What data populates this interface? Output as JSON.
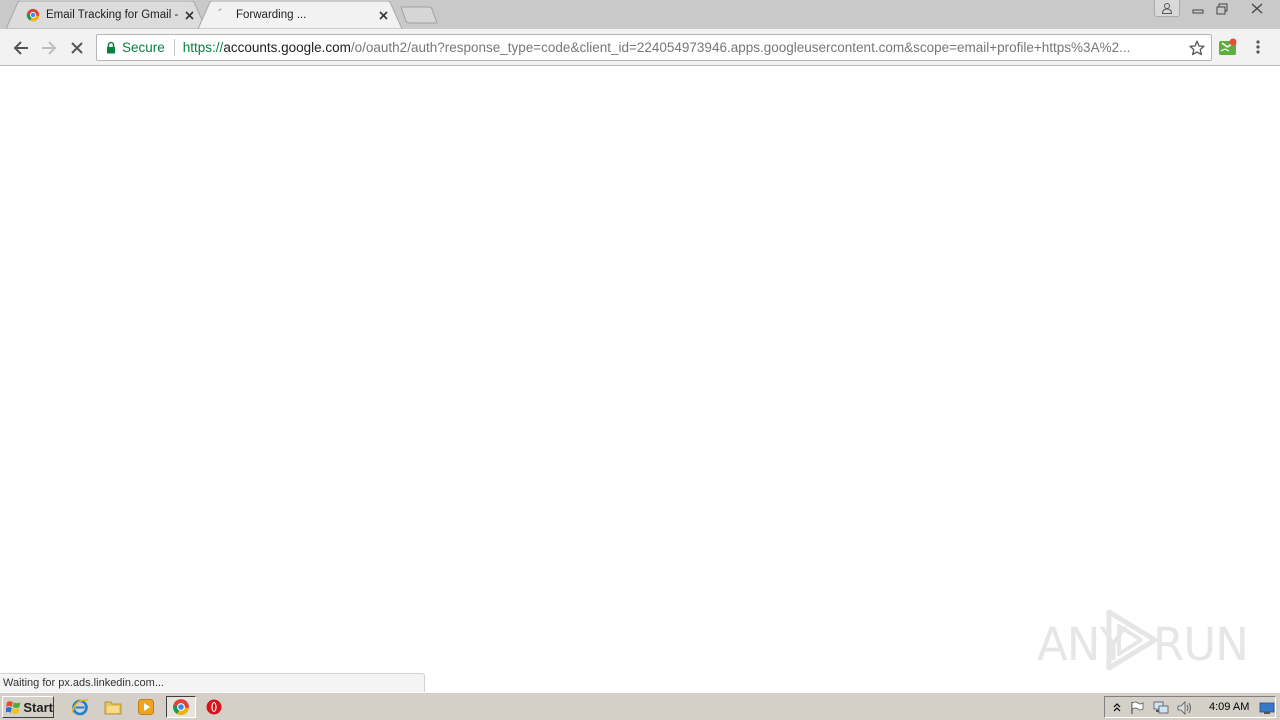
{
  "browser": {
    "tabs": [
      {
        "title": "Email Tracking for Gmail - Ma",
        "favicon": "chrome-tab-icon",
        "active": false
      },
      {
        "title": "Forwarding ...",
        "favicon": "loading-spinner-icon",
        "active": true
      }
    ],
    "omnibox": {
      "secure_label": "Secure",
      "url_scheme": "https://",
      "url_host": "accounts.google.com",
      "url_path": "/o/oauth2/auth?response_type=code&client_id=224054973946.apps.googleusercontent.com&scope=email+profile+https%3A%2..."
    },
    "status_text": "Waiting for px.ads.linkedin.com..."
  },
  "watermark": {
    "left": "ANY",
    "right": "RUN"
  },
  "taskbar": {
    "start_label": "Start",
    "apps": [
      "internet-explorer-icon",
      "file-explorer-icon",
      "media-player-icon",
      "chrome-icon",
      "opera-icon"
    ],
    "clock": "4:09 AM"
  },
  "colors": {
    "secure_green": "#0b8043",
    "tabstrip": "#c9c9c9",
    "toolbar": "#f2f2f2",
    "taskbar": "#d4d0c8"
  }
}
